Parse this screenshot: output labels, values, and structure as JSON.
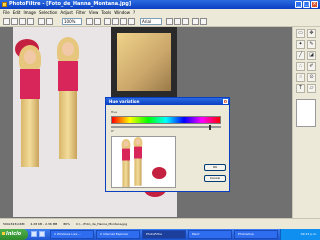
{
  "window": {
    "title": "PhotoFiltre - [Foto_de_Hanna_Montana.jpg]"
  },
  "menu": [
    "File",
    "Edit",
    "Image",
    "Selection",
    "Adjust",
    "Filter",
    "View",
    "Tools",
    "Window",
    "?"
  ],
  "toolbar": {
    "zoom_value": "100%",
    "font_value": "Arial"
  },
  "dialog": {
    "title": "Hue variation",
    "hue_label": "Hue",
    "hue_value": "0°",
    "hue_position_fraction": 0.9,
    "ok_label": "OK",
    "cancel_label": "Cancel"
  },
  "status": {
    "dimensions": "500x343x16M",
    "info": "4.28 KB - 2.36 MB",
    "zoom": "80%",
    "file": "C:\\...\\Foto_de_Hanna_Montana.jpg"
  },
  "taskbar": {
    "start_label": "Inicio",
    "tasks": [
      "2 Windows Live ...",
      "2 Internet Explorer",
      "PhotoFiltre",
      "Paint",
      "Photoshop"
    ],
    "clock": "09:13 p.m."
  },
  "colors": {
    "titlebar": "#0a3fc2",
    "canvas": "#707070",
    "pink_top": "#d8265a",
    "taskbar": "#1f56cf",
    "start": "#2e8a2c"
  }
}
